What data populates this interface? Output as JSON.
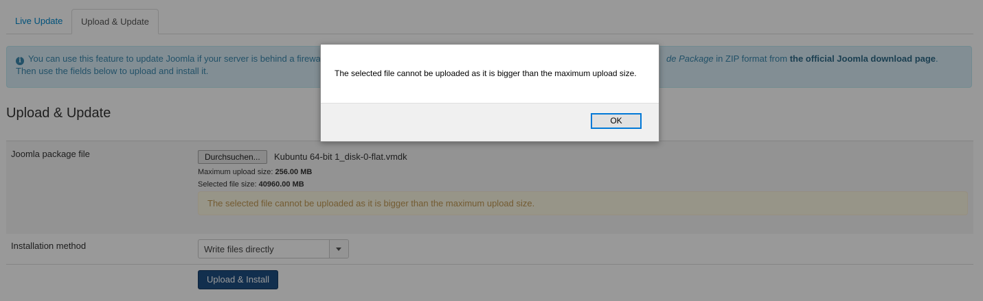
{
  "tabs": [
    {
      "label": "Live Update"
    },
    {
      "label": "Upload & Update"
    }
  ],
  "info_alert": {
    "icon": "info-icon",
    "line1_start": "You can use this feature to update Joomla if your server is behind a firewa",
    "line1_end_italic": "de Package",
    "line1_end_text": " in ZIP format from ",
    "line1_end_bold": "the official Joomla download page",
    "line1_end_dot": ".",
    "line2": "Then use the fields below to upload and install it."
  },
  "section_title": "Upload & Update",
  "form": {
    "package_label": "Joomla package file",
    "browse_button": "Durchsuchen...",
    "file_name": "Kubuntu 64-bit 1_disk-0-flat.vmdk",
    "max_upload_label": "Maximum upload size: ",
    "max_upload_value": "256.00 MB",
    "selected_size_label": "Selected file size: ",
    "selected_size_value": "40960.00 MB",
    "warning": "The selected file cannot be uploaded as it is bigger than the maximum upload size.",
    "method_label": "Installation method",
    "method_value": "Write files directly",
    "submit_button": "Upload & Install"
  },
  "dialog": {
    "message": "The selected file cannot be uploaded as it is bigger than the maximum upload size.",
    "ok_button": "OK"
  }
}
